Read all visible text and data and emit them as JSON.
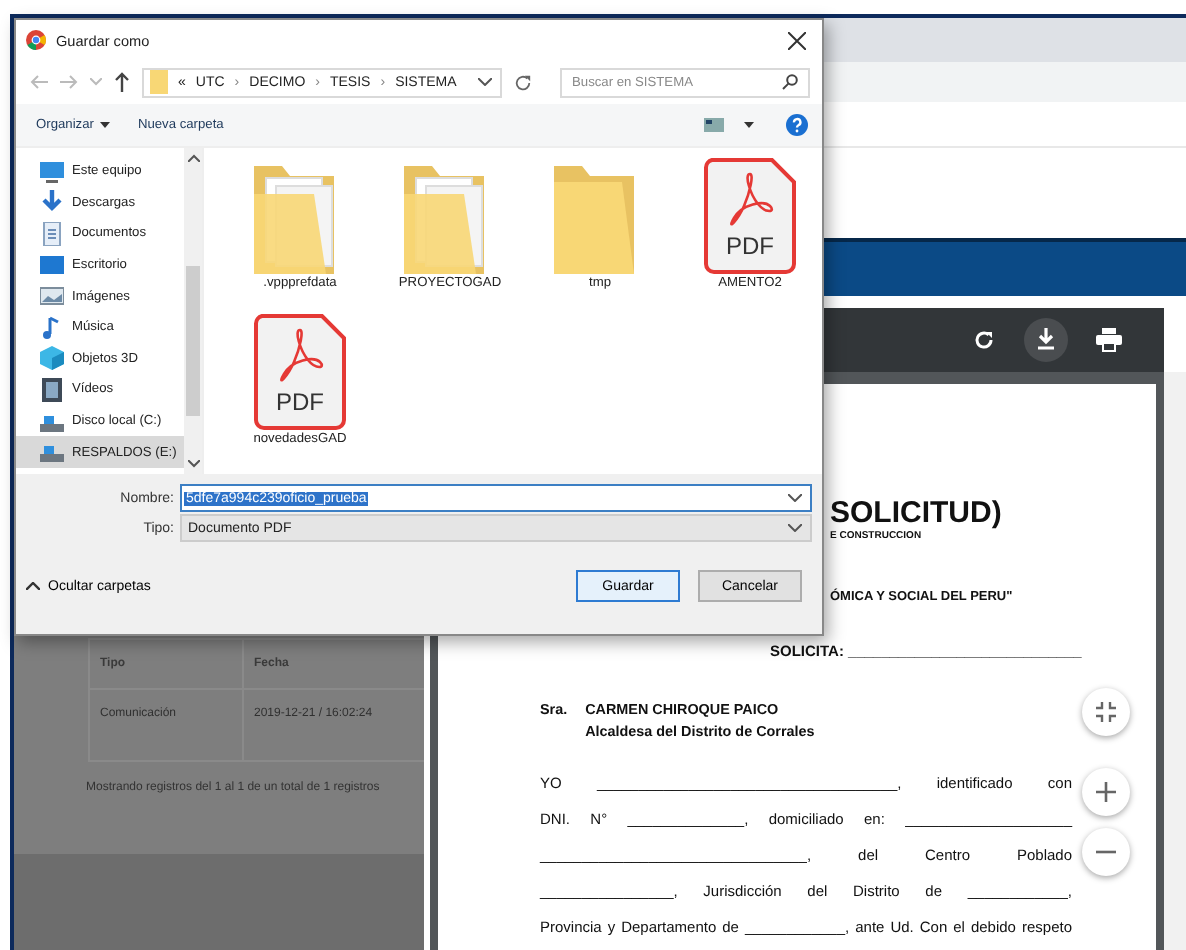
{
  "dialog": {
    "title": "Guardar como",
    "address": {
      "prefix": "«",
      "path": [
        "UTC",
        "DECIMO",
        "TESIS",
        "SISTEMA"
      ],
      "separator": "›"
    },
    "search": {
      "placeholder": "Buscar en SISTEMA"
    },
    "toolbar": {
      "organize": "Organizar",
      "new_folder": "Nueva carpeta"
    },
    "sidebar": [
      {
        "label": "Este equipo",
        "kind": "computer",
        "selected": false
      },
      {
        "label": "Descargas",
        "kind": "download",
        "selected": false
      },
      {
        "label": "Documentos",
        "kind": "document",
        "selected": false
      },
      {
        "label": "Escritorio",
        "kind": "desktop",
        "selected": false
      },
      {
        "label": "Imágenes",
        "kind": "images",
        "selected": false
      },
      {
        "label": "Música",
        "kind": "music",
        "selected": false
      },
      {
        "label": "Objetos 3D",
        "kind": "cube",
        "selected": false
      },
      {
        "label": "Vídeos",
        "kind": "video",
        "selected": false
      },
      {
        "label": "Disco local (C:)",
        "kind": "drive",
        "selected": false
      },
      {
        "label": "RESPALDOS (E:)",
        "kind": "drive",
        "selected": true
      }
    ],
    "files": [
      {
        "name": ".vppprefdata",
        "kind": "folder_docs"
      },
      {
        "name": "PROYECTOGAD",
        "kind": "folder_docs"
      },
      {
        "name": "tmp",
        "kind": "folder"
      },
      {
        "name": "AMENTO2",
        "kind": "pdf",
        "icon_text": "PDF"
      },
      {
        "name": "novedadesGAD",
        "kind": "pdf",
        "icon_text": "PDF"
      }
    ],
    "name_label": "Nombre:",
    "name_value": "5dfe7a994c239oficio_prueba",
    "type_label": "Tipo:",
    "type_value": "Documento PDF",
    "hide_folders": "Ocultar carpetas",
    "buttons": [
      {
        "label": "Guardar",
        "default": true
      },
      {
        "label": "Cancelar",
        "default": false
      }
    ]
  },
  "background_table": {
    "columns": [
      "Tipo",
      "Fecha"
    ],
    "rows": [
      [
        "Comunicación",
        "2019-12-21 / 16:02:24"
      ]
    ],
    "footer": "Mostrando registros del 1 al 1 de un total de 1 registros"
  },
  "document": {
    "heading": "SOLICITUD)",
    "subheading": "E CONSTRUCCION",
    "motto": "ÓMICA Y SOCIAL DEL PERU\"",
    "solicita": "SOLICITA: ____________________________",
    "salutation": "Sra.",
    "addressee": "CARMEN CHIROQUE PAICO",
    "addressee_title": "Alcaldesa del Distrito de Corrales",
    "lines": [
      "YO ____________________________________, identificado con",
      "DNI. N° ______________, domiciliado en: ____________________",
      "________________________________, del Centro Poblado",
      "________________, Jurisdicción del Distrito de ____________,",
      "Provincia y Departamento de ____________, ante Ud. Con el debido respeto"
    ]
  }
}
